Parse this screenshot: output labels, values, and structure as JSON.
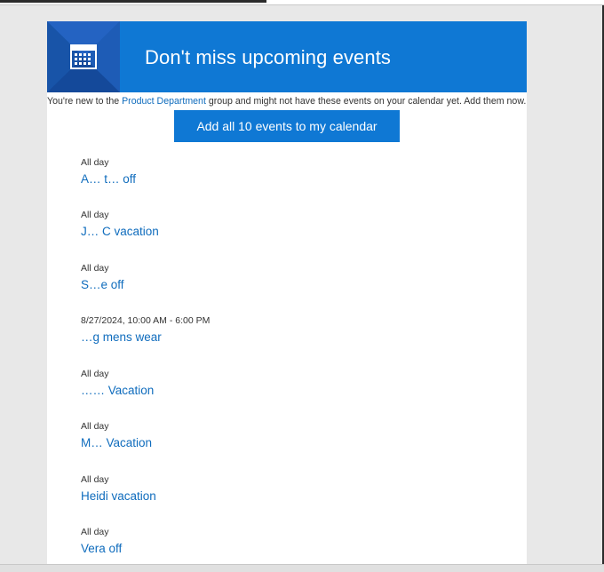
{
  "banner": {
    "title": "Don't miss upcoming events",
    "icon": "calendar-icon",
    "color": "#0f78d4"
  },
  "intro": {
    "before": "You're new to the ",
    "group_link": "Product Department",
    "after": " group and might not have these events on your calendar yet. Add them now."
  },
  "add_button": {
    "label": "Add all 10 events to my calendar"
  },
  "events": [
    {
      "time": "All day",
      "title": "A… t… off"
    },
    {
      "time": "All day",
      "title": "J… C vacation"
    },
    {
      "time": "All day",
      "title": "S…e off"
    },
    {
      "time": "8/27/2024, 10:00 AM - 6:00 PM",
      "title": "…g mens wear"
    },
    {
      "time": "All day",
      "title": "…… Vacation"
    },
    {
      "time": "All day",
      "title": "M… Vacation"
    },
    {
      "time": "All day",
      "title": "Heidi vacation"
    },
    {
      "time": "All day",
      "title": "Vera off"
    }
  ],
  "colors": {
    "accent": "#0f78d4",
    "link": "#0f6cbd",
    "tile": "#1a5fb8"
  }
}
